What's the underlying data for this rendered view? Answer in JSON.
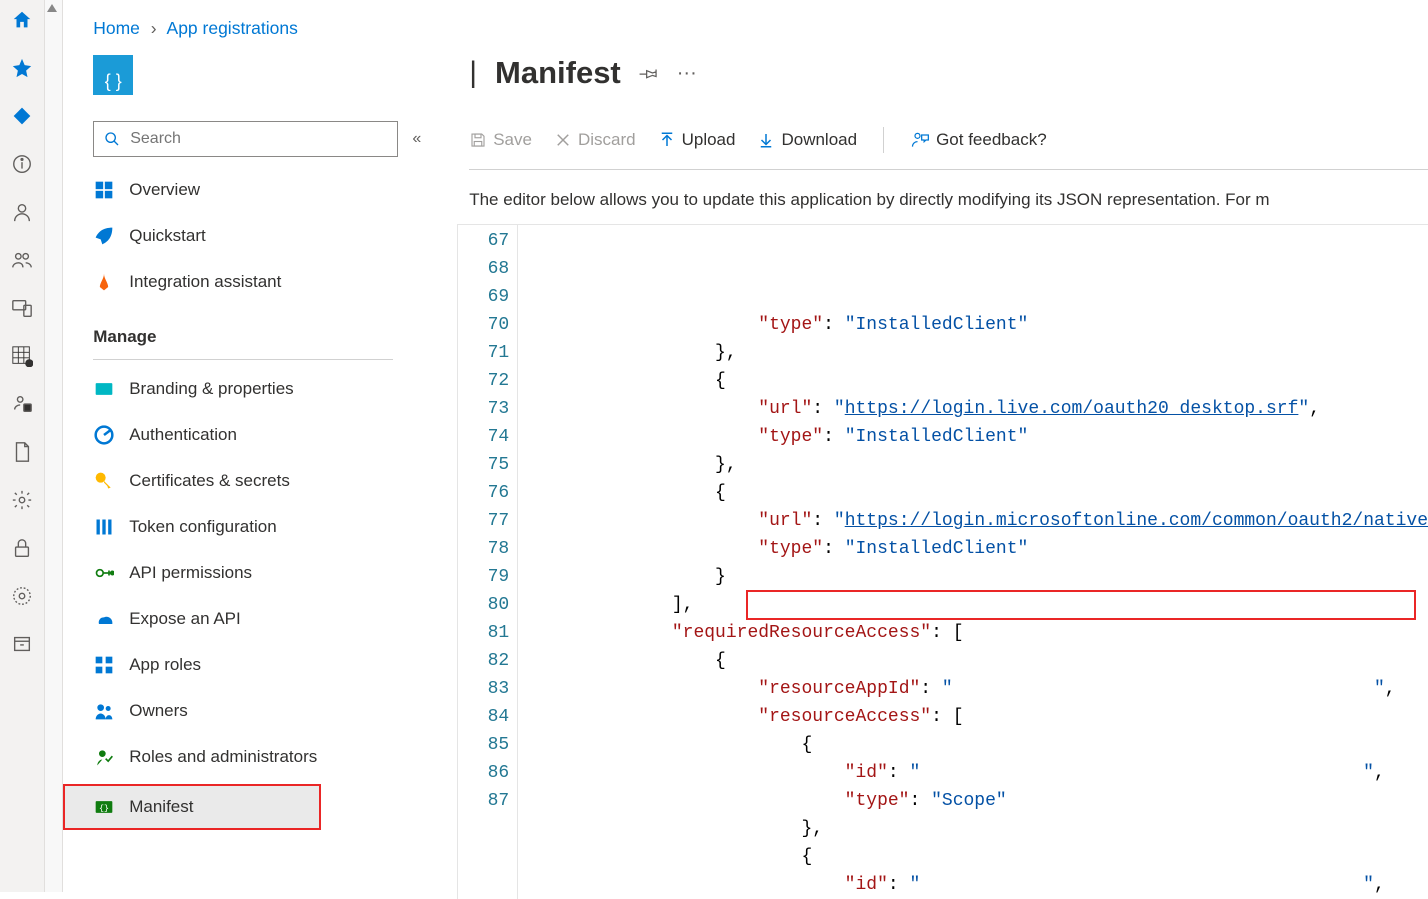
{
  "breadcrumb": {
    "home": "Home",
    "second": "App registrations"
  },
  "search": {
    "placeholder": "Search"
  },
  "nav": {
    "overview": "Overview",
    "quickstart": "Quickstart",
    "integration": "Integration assistant",
    "manageHeader": "Manage",
    "branding": "Branding & properties",
    "auth": "Authentication",
    "certs": "Certificates & secrets",
    "token": "Token configuration",
    "api": "API permissions",
    "expose": "Expose an API",
    "roles": "App roles",
    "owners": "Owners",
    "adminroles": "Roles and administrators",
    "manifest": "Manifest"
  },
  "page": {
    "title": "Manifest"
  },
  "toolbar": {
    "save": "Save",
    "discard": "Discard",
    "upload": "Upload",
    "download": "Download",
    "feedback": "Got feedback?"
  },
  "info": "The editor below allows you to update this application by directly modifying its JSON representation. For m",
  "code": {
    "lines": [
      {
        "n": 67,
        "i": 5,
        "parts": [
          {
            "c": "k",
            "t": "\"type\""
          },
          {
            "c": "p",
            "t": ": "
          },
          {
            "c": "s",
            "t": "\"InstalledClient\""
          }
        ],
        "trail": ""
      },
      {
        "n": 68,
        "i": 4,
        "parts": [
          {
            "c": "p",
            "t": "},"
          }
        ],
        "trail": ""
      },
      {
        "n": 69,
        "i": 4,
        "parts": [
          {
            "c": "p",
            "t": "{"
          }
        ],
        "trail": ""
      },
      {
        "n": 70,
        "i": 5,
        "parts": [
          {
            "c": "k",
            "t": "\"url\""
          },
          {
            "c": "p",
            "t": ": "
          },
          {
            "c": "s",
            "t": "\""
          },
          {
            "c": "u",
            "t": "https://login.live.com/oauth20_desktop.srf"
          },
          {
            "c": "s",
            "t": "\""
          },
          {
            "c": "p",
            "t": ","
          }
        ],
        "trail": ""
      },
      {
        "n": 71,
        "i": 5,
        "parts": [
          {
            "c": "k",
            "t": "\"type\""
          },
          {
            "c": "p",
            "t": ": "
          },
          {
            "c": "s",
            "t": "\"InstalledClient\""
          }
        ],
        "trail": ""
      },
      {
        "n": 72,
        "i": 4,
        "parts": [
          {
            "c": "p",
            "t": "},"
          }
        ],
        "trail": ""
      },
      {
        "n": 73,
        "i": 4,
        "parts": [
          {
            "c": "p",
            "t": "{"
          }
        ],
        "trail": ""
      },
      {
        "n": 74,
        "i": 5,
        "parts": [
          {
            "c": "k",
            "t": "\"url\""
          },
          {
            "c": "p",
            "t": ": "
          },
          {
            "c": "s",
            "t": "\""
          },
          {
            "c": "u",
            "t": "https://login.microsoftonline.com/common/oauth2/native"
          }
        ],
        "trail": ""
      },
      {
        "n": 75,
        "i": 5,
        "parts": [
          {
            "c": "k",
            "t": "\"type\""
          },
          {
            "c": "p",
            "t": ": "
          },
          {
            "c": "s",
            "t": "\"InstalledClient\""
          }
        ],
        "trail": ""
      },
      {
        "n": 76,
        "i": 4,
        "parts": [
          {
            "c": "p",
            "t": "}"
          }
        ],
        "trail": ""
      },
      {
        "n": 77,
        "i": 3,
        "parts": [
          {
            "c": "p",
            "t": "],"
          }
        ],
        "trail": ""
      },
      {
        "n": 78,
        "i": 3,
        "parts": [
          {
            "c": "k",
            "t": "\"requiredResourceAccess\""
          },
          {
            "c": "p",
            "t": ": ["
          }
        ],
        "trail": ""
      },
      {
        "n": 79,
        "i": 4,
        "parts": [
          {
            "c": "p",
            "t": "{"
          }
        ],
        "trail": ""
      },
      {
        "n": 80,
        "i": 5,
        "parts": [
          {
            "c": "k",
            "t": "\"resourceAppId\""
          },
          {
            "c": "p",
            "t": ": "
          },
          {
            "c": "s",
            "t": "\""
          },
          {
            "c": "s",
            "t": "                                       \""
          },
          {
            "c": "p",
            "t": ","
          }
        ],
        "trail": ""
      },
      {
        "n": 81,
        "i": 5,
        "parts": [
          {
            "c": "k",
            "t": "\"resourceAccess\""
          },
          {
            "c": "p",
            "t": ": ["
          }
        ],
        "trail": ""
      },
      {
        "n": 82,
        "i": 6,
        "parts": [
          {
            "c": "p",
            "t": "{"
          }
        ],
        "trail": ""
      },
      {
        "n": 83,
        "i": 7,
        "parts": [
          {
            "c": "k",
            "t": "\"id\""
          },
          {
            "c": "p",
            "t": ": "
          },
          {
            "c": "s",
            "t": "\""
          },
          {
            "c": "s",
            "t": "                                         \""
          },
          {
            "c": "p",
            "t": ","
          }
        ],
        "trail": ""
      },
      {
        "n": 84,
        "i": 7,
        "parts": [
          {
            "c": "k",
            "t": "\"type\""
          },
          {
            "c": "p",
            "t": ": "
          },
          {
            "c": "s",
            "t": "\"Scope\""
          }
        ],
        "trail": ""
      },
      {
        "n": 85,
        "i": 6,
        "parts": [
          {
            "c": "p",
            "t": "},"
          }
        ],
        "trail": ""
      },
      {
        "n": 86,
        "i": 6,
        "parts": [
          {
            "c": "p",
            "t": "{"
          }
        ],
        "trail": ""
      },
      {
        "n": 87,
        "i": 7,
        "parts": [
          {
            "c": "k",
            "t": "\"id\""
          },
          {
            "c": "p",
            "t": ": "
          },
          {
            "c": "s",
            "t": "\""
          },
          {
            "c": "s",
            "t": "                                         \""
          },
          {
            "c": "p",
            "t": ","
          }
        ],
        "trail": ""
      }
    ]
  }
}
